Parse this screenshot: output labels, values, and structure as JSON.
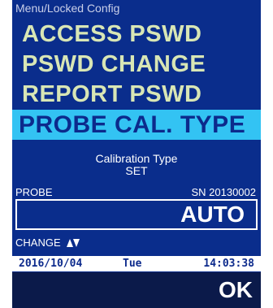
{
  "header": {
    "title": "Menu/Locked Config"
  },
  "menu": {
    "items": [
      {
        "label": "ACCESS PSWD"
      },
      {
        "label": "PSWD CHANGE"
      },
      {
        "label": "REPORT PSWD"
      },
      {
        "label": "PROBE CAL. TYPE"
      }
    ],
    "selected": "PROBE CAL. TYPE"
  },
  "calibration": {
    "title_line1": "Calibration Type",
    "title_line2": "SET",
    "probe_label": "PROBE",
    "serial": "SN 20130002",
    "value": "AUTO"
  },
  "change": {
    "label": "CHANGE",
    "icon": "up-down-arrows-icon"
  },
  "status": {
    "date": "2016/10/04",
    "day": "Tue",
    "time": "14:03:38"
  },
  "softkey": {
    "ok_label": "OK"
  },
  "colors": {
    "background": "#0a2d8c",
    "menu_text": "#d8e6b5",
    "selection": "#33c3f3",
    "ok_bar": "#0b1a4a"
  }
}
